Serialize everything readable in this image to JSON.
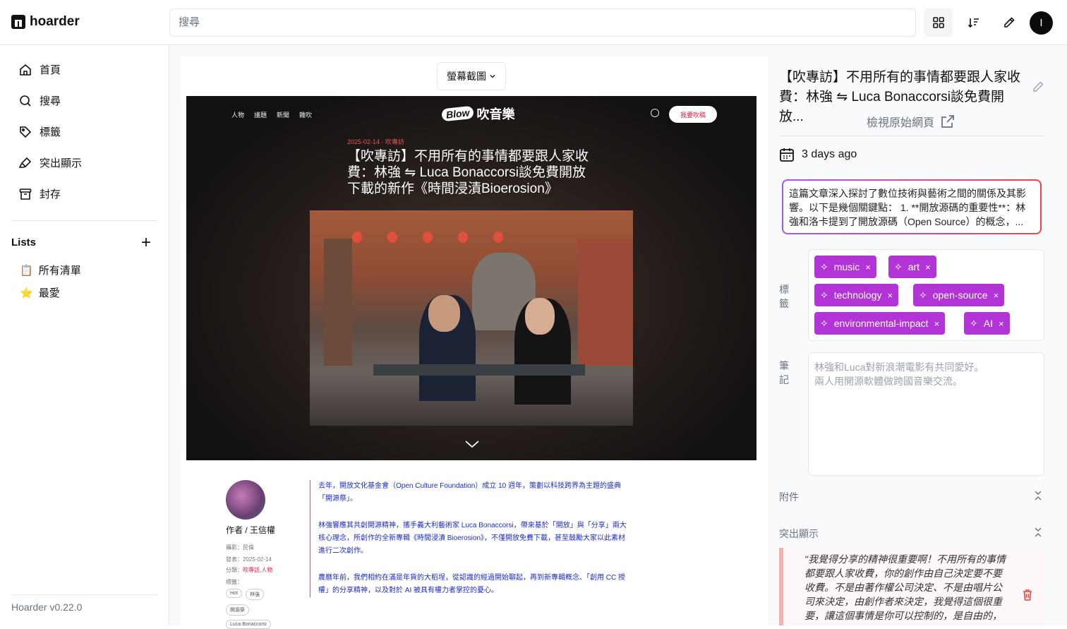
{
  "app": {
    "name": "hoarder",
    "version": "Hoarder v0.22.0"
  },
  "header": {
    "search_placeholder": "搜尋",
    "avatar_initial": "I"
  },
  "sidebar": {
    "items": [
      {
        "label": "首頁",
        "icon": "home-icon"
      },
      {
        "label": "搜尋",
        "icon": "search-icon"
      },
      {
        "label": "標籤",
        "icon": "tag-icon"
      },
      {
        "label": "突出顯示",
        "icon": "highlighter-icon"
      },
      {
        "label": "封存",
        "icon": "archive-icon"
      }
    ],
    "lists_title": "Lists",
    "lists": [
      {
        "label": "所有清單",
        "icon": "📋"
      },
      {
        "label": "最愛",
        "icon": "⭐"
      }
    ]
  },
  "preview": {
    "view_mode": "螢幕截圖",
    "site": {
      "nav": [
        "人物",
        "議題",
        "新聞",
        "雜吹"
      ],
      "brand_badge": "Blow",
      "brand_name": "吹音樂",
      "cta": "我要吹稿",
      "date_line": "2025-02-14 · 吹專訪",
      "title": "【吹專訪】不用所有的事情都要跟人家收費：林強 ⇋ Luca Bonaccorsi談免費開放下載的新作《時間浸漬Bioerosion》"
    },
    "author": {
      "name": "作者 / 王信權",
      "photo_line": "攝影：民倫",
      "publish_line": "發表：2025-02-14",
      "category_label": "分類：",
      "category_value": "吹專訪,人物",
      "tags_label": "標籤：",
      "tags": [
        "Hot",
        "林強",
        "開源祭",
        "Luca Bonaccorsi"
      ]
    },
    "paragraphs": [
      "去年，開放文化基金會（Open Culture Foundation）成立 10 週年，策劃以科技跨界為主題的盛典「開源祭」。",
      "林強響應其共創開源精神，攜手義大利藝術家 Luca Bonaccorsi，帶來基於「開放」與「分享」兩大核心理念，所創作的全新專輯《時間浸漬 Bioerosion》，不僅開放免費下載，甚至鼓勵大家以此素材進行二次創作。",
      "農曆年前，我們相約在滿是年貨的大稻埕，從認識的經過開始聊起，再到新專輯概念、「創用 CC 授權」的分享精神，以及對於 AI 被具有權力者掌控的憂心。"
    ]
  },
  "detail": {
    "title": "【吹專訪】不用所有的事情都要跟人家收費：林強 ⇋ Luca Bonaccorsi談免費開放...",
    "view_original": "檢視原始網頁",
    "date": "3 days ago",
    "summary": "這篇文章深入探討了數位技術與藝術之間的關係及其影響。以下是幾個關鍵點： 1. **開放源碼的重要性**：林強和洛卡提到了開放源碼（Open Source）的概念，...",
    "tags_label": "標籤",
    "tags": [
      "music",
      "art",
      "technology",
      "open-source",
      "environmental-impact",
      "AI"
    ],
    "notes_label": "筆記",
    "notes_line1": "林強和Luca對新浪潮電影有共同愛好。",
    "notes_line2": "兩人用開源軟體做跨國音樂交流。",
    "attachments_label": "附件",
    "highlights_label": "突出顯示",
    "highlight_text": "\"我覺得分享的精神很重要啊！不用所有的事情都要跟人家收費，你的創作由自己決定要不要收費。不是由著作權公司決定、不是由唱片公司來決定，由創作者來決定，我覺得這個很重要，讓這個事情是你可以控制的，是自由的，"
  },
  "colors": {
    "tag_bg": "#b334d6",
    "summary_gradient_start": "#a855f7",
    "summary_gradient_end": "#ef4444",
    "highlight_border": "#f3b2aa"
  }
}
